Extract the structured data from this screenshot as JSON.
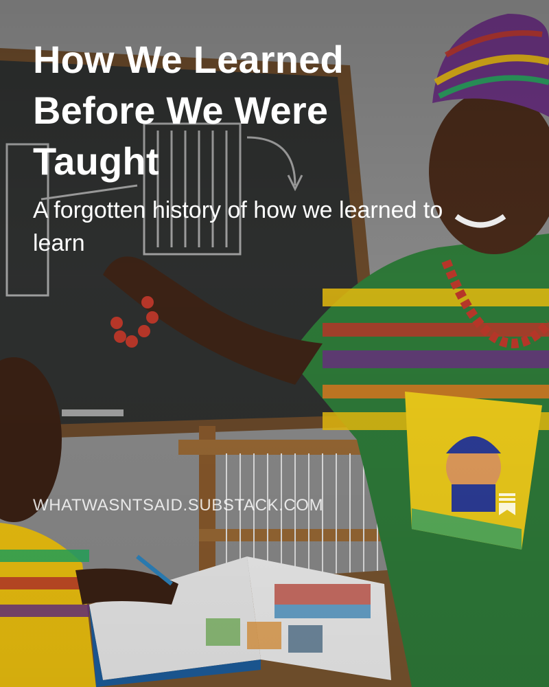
{
  "post": {
    "title": "How We Learned Before We Were Taught",
    "subtitle": "A forgotten history of how we learned to learn",
    "publication_domain": "WHATWASNTSAID.SUBSTACK.COM"
  },
  "icons": {
    "save": "bookmark-icon"
  },
  "colors": {
    "background": "#8a8a8a",
    "chalkboard": "#2e2e2e",
    "text": "#ffffff"
  }
}
